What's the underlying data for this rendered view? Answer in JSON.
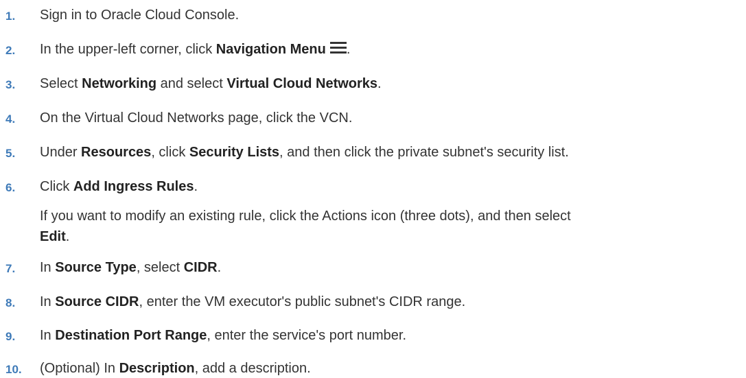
{
  "steps": [
    {
      "num": "1.",
      "parts": [
        {
          "t": "Sign in to Oracle Cloud Console."
        }
      ]
    },
    {
      "num": "2.",
      "parts": [
        {
          "t": "In the upper-left corner, click "
        },
        {
          "t": "Navigation Menu",
          "b": true
        }
      ],
      "icon": "hamburger-menu-icon",
      "after_icon": "."
    },
    {
      "num": "3.",
      "parts": [
        {
          "t": "Select "
        },
        {
          "t": "Networking",
          "b": true
        },
        {
          "t": " and select "
        },
        {
          "t": "Virtual Cloud Networks",
          "b": true
        },
        {
          "t": "."
        }
      ]
    },
    {
      "num": "4.",
      "parts": [
        {
          "t": "On the Virtual Cloud Networks page, click the VCN."
        }
      ]
    },
    {
      "num": "5.",
      "parts": [
        {
          "t": "Under "
        },
        {
          "t": "Resources",
          "b": true
        },
        {
          "t": ", click "
        },
        {
          "t": "Security Lists",
          "b": true
        },
        {
          "t": ", and then click the private subnet's security list."
        }
      ]
    },
    {
      "num": "6.",
      "parts": [
        {
          "t": "Click "
        },
        {
          "t": "Add Ingress Rules",
          "b": true
        },
        {
          "t": "."
        }
      ]
    },
    {
      "num": "7.",
      "parts": [
        {
          "t": "In "
        },
        {
          "t": "Source Type",
          "b": true
        },
        {
          "t": ", select "
        },
        {
          "t": "CIDR",
          "b": true
        },
        {
          "t": "."
        }
      ]
    },
    {
      "num": "8.",
      "parts": [
        {
          "t": "In "
        },
        {
          "t": "Source CIDR",
          "b": true
        },
        {
          "t": ", enter the VM executor's public subnet's CIDR range."
        }
      ]
    },
    {
      "num": "9.",
      "parts": [
        {
          "t": "In "
        },
        {
          "t": "Destination Port Range",
          "b": true
        },
        {
          "t": ", enter the service's port number."
        }
      ]
    },
    {
      "num": "10.",
      "parts": [
        {
          "t": "(Optional) In "
        },
        {
          "t": "Description",
          "b": true
        },
        {
          "t": ", add a description."
        }
      ]
    }
  ],
  "note": {
    "line1": "If you want to modify an existing rule, click the Actions icon (three dots), and then select",
    "line2_bold": "Edit",
    "line2_rest": "."
  }
}
